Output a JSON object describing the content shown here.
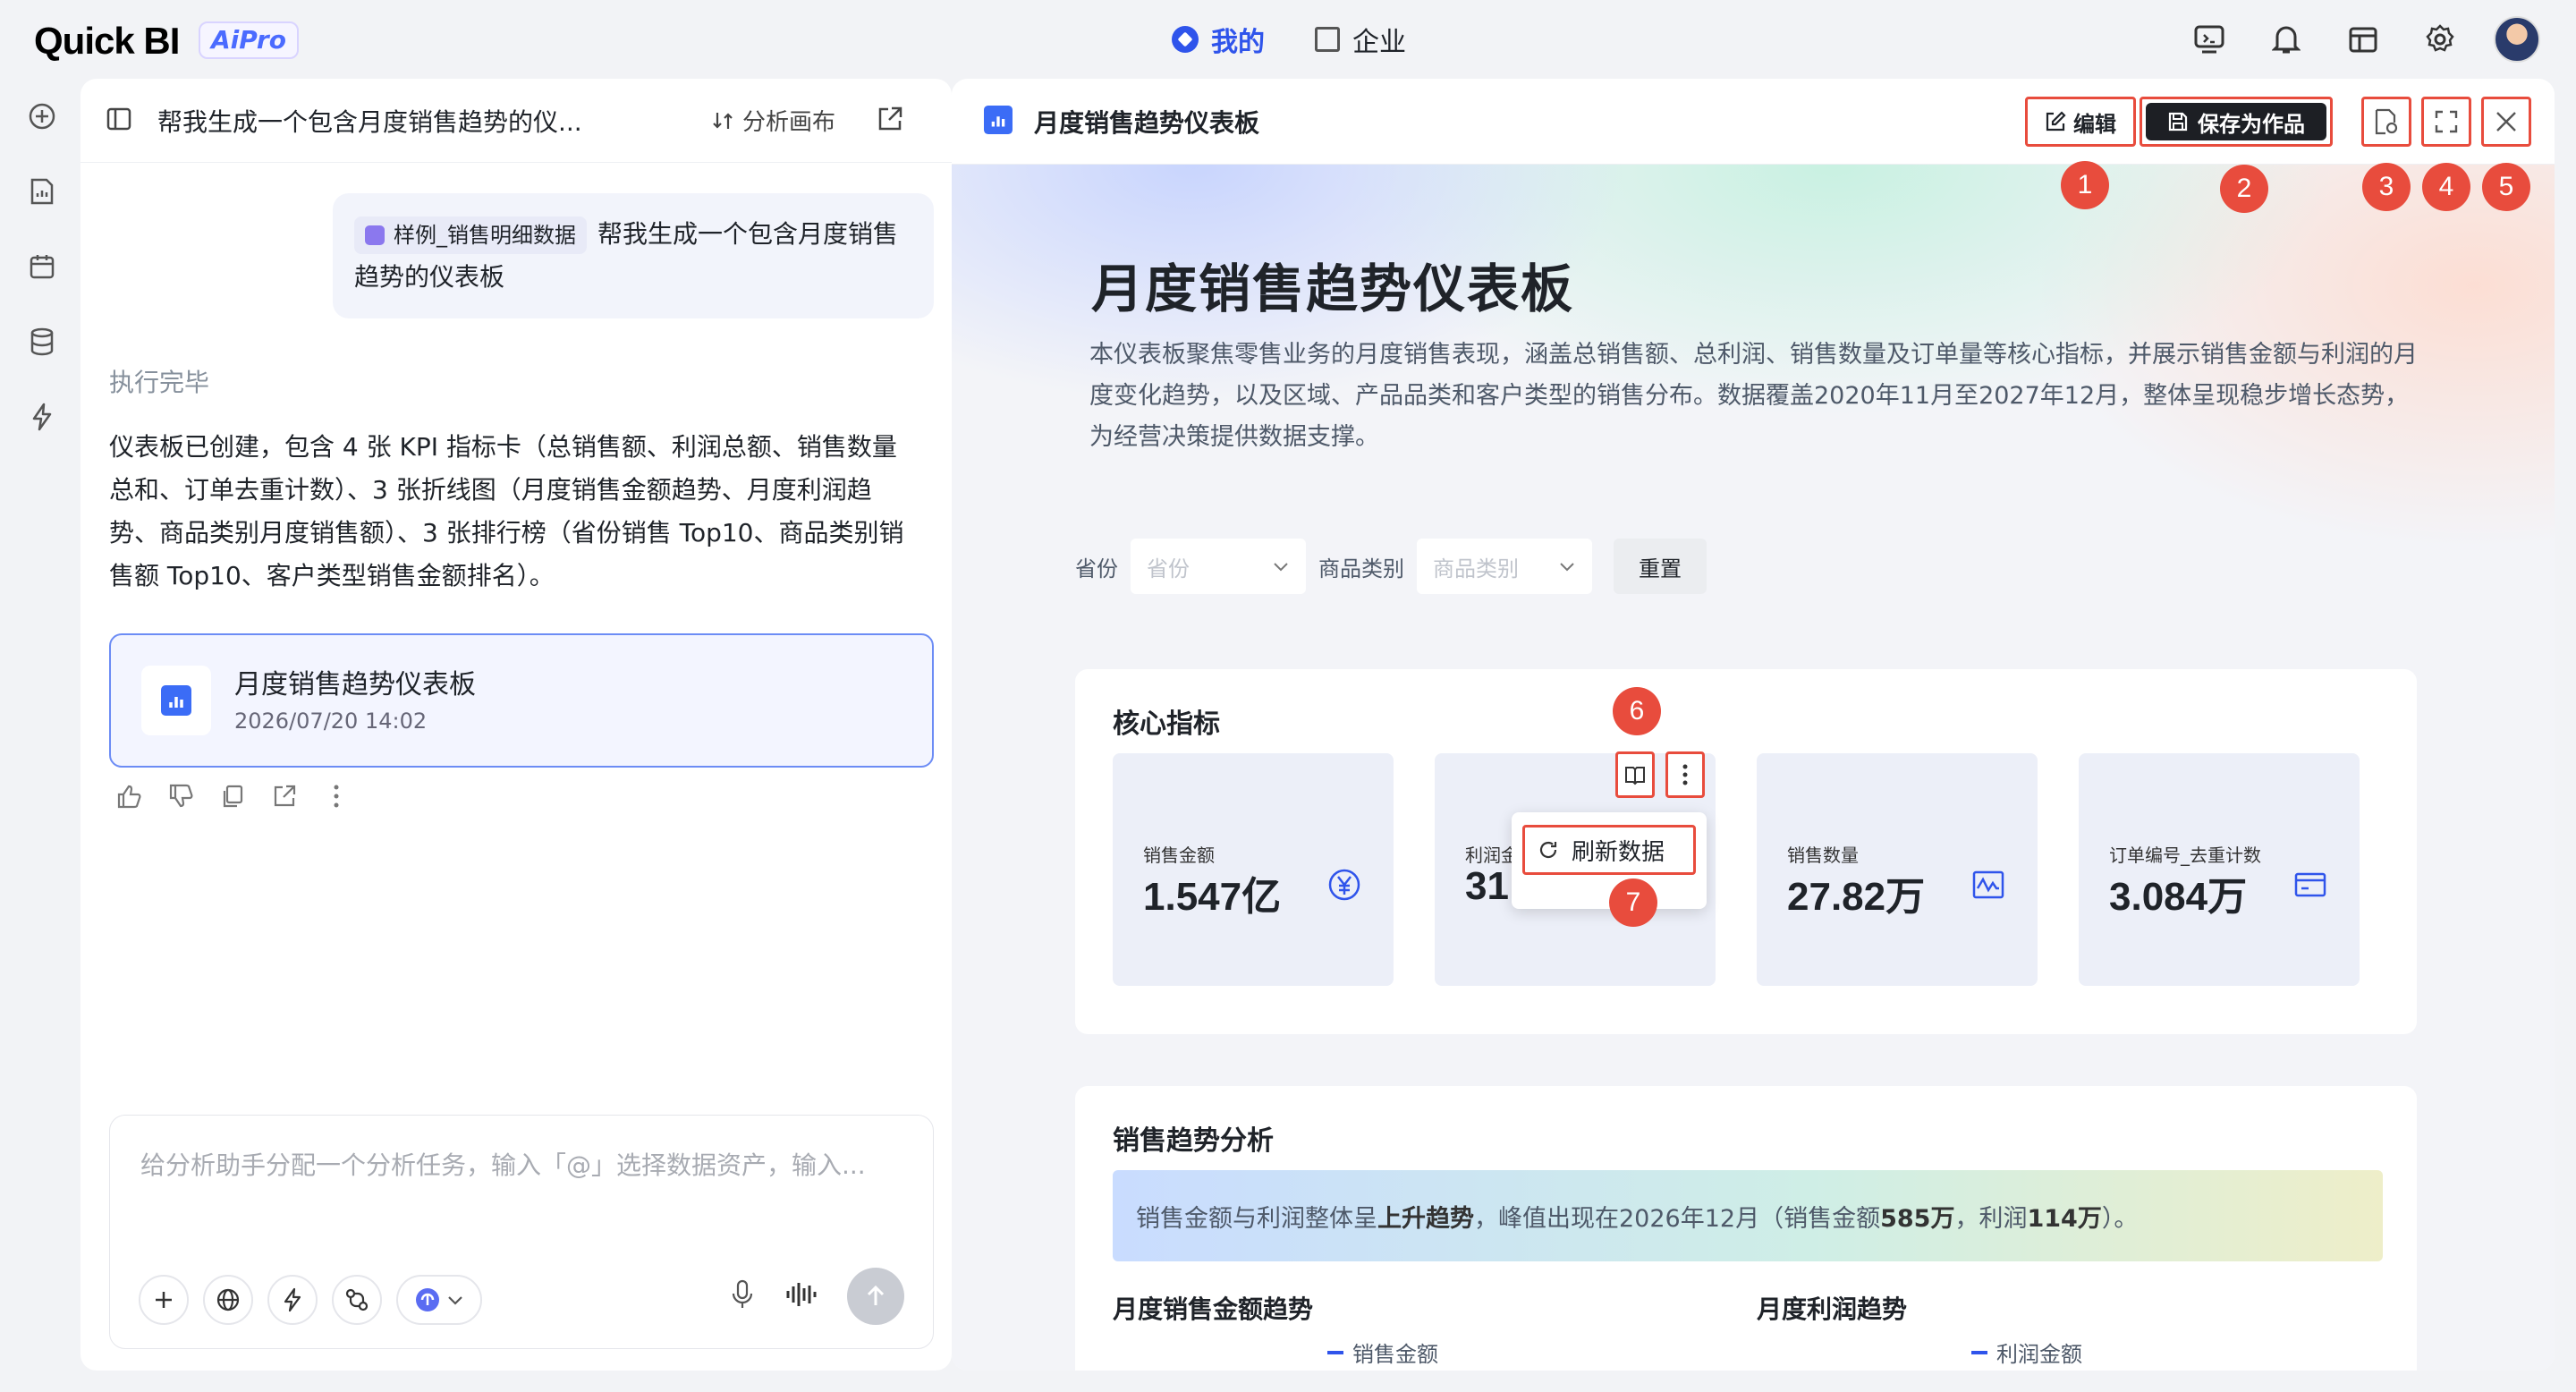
{
  "app": {
    "logo": "Quick BI",
    "badge": "AiPro"
  },
  "nav": {
    "mine": "我的",
    "enterprise": "企业"
  },
  "chat": {
    "title": "帮我生成一个包含月度销售趋势的仪...",
    "canvas_link": "分析画布",
    "user_message": {
      "chip": "样例_销售明细数据",
      "text": "帮我生成一个包含月度销售趋势的仪表板"
    },
    "status": "执行完毕",
    "answer": "仪表板已创建，包含 4 张 KPI 指标卡（总销售额、利润总额、销售数量总和、订单去重计数）、3 张折线图（月度销售金额趋势、月度利润趋势、商品类别月度销售额）、3 张排行榜（省份销售 Top10、商品类别销售额 Top10、客户类型销售金额排名）。",
    "result_card": {
      "title": "月度销售趋势仪表板",
      "time": "2026/07/20 14:02"
    },
    "input_placeholder": "给分析助手分配一个分析任务，输入「@」选择数据资产，输入..."
  },
  "dashboard": {
    "header_title": "月度销售趋势仪表板",
    "edit_label": "编辑",
    "save_label": "保存为作品",
    "badges": [
      "1",
      "2",
      "3",
      "4",
      "5",
      "6",
      "7"
    ],
    "hero_title": "月度销售趋势仪表板",
    "hero_desc": "本仪表板聚焦零售业务的月度销售表现，涵盖总销售额、总利润、销售数量及订单量等核心指标，并展示销售金额与利润的月度变化趋势，以及区域、产品品类和客户类型的销售分布。数据覆盖2020年11月至2027年12月，整体呈现稳步增长态势，为经营决策提供数据支撑。",
    "filters": {
      "province_label": "省份",
      "province_placeholder": "省份",
      "category_label": "商品类别",
      "category_placeholder": "商品类别",
      "reset": "重置"
    },
    "kpi_section": "核心指标",
    "kpis": [
      {
        "label": "销售金额",
        "value": "1.547亿",
        "icon": "yuan-icon"
      },
      {
        "label": "利润金",
        "value": "31",
        "icon": "profit-icon"
      },
      {
        "label": "销售数量",
        "value": "27.82万",
        "icon": "wave-chart-icon"
      },
      {
        "label": "订单编号_去重计数",
        "value": "3.084万",
        "icon": "card-icon"
      }
    ],
    "menu_refresh": "刷新数据",
    "trend_section": "销售趋势分析",
    "insight": {
      "p1": "销售金额与利润整体呈",
      "b1": "上升趋势",
      "p2": "，峰值出现在2026年12月（销售金额",
      "b2": "585万",
      "p3": "，利润",
      "b3": "114万",
      "p4": "）。"
    },
    "charts": [
      {
        "title": "月度销售金额趋势",
        "legend": "销售金额"
      },
      {
        "title": "月度利润趋势",
        "legend": "利润金额"
      }
    ],
    "accent_color": "#2f54eb",
    "annotation_color": "#e84c3d"
  }
}
